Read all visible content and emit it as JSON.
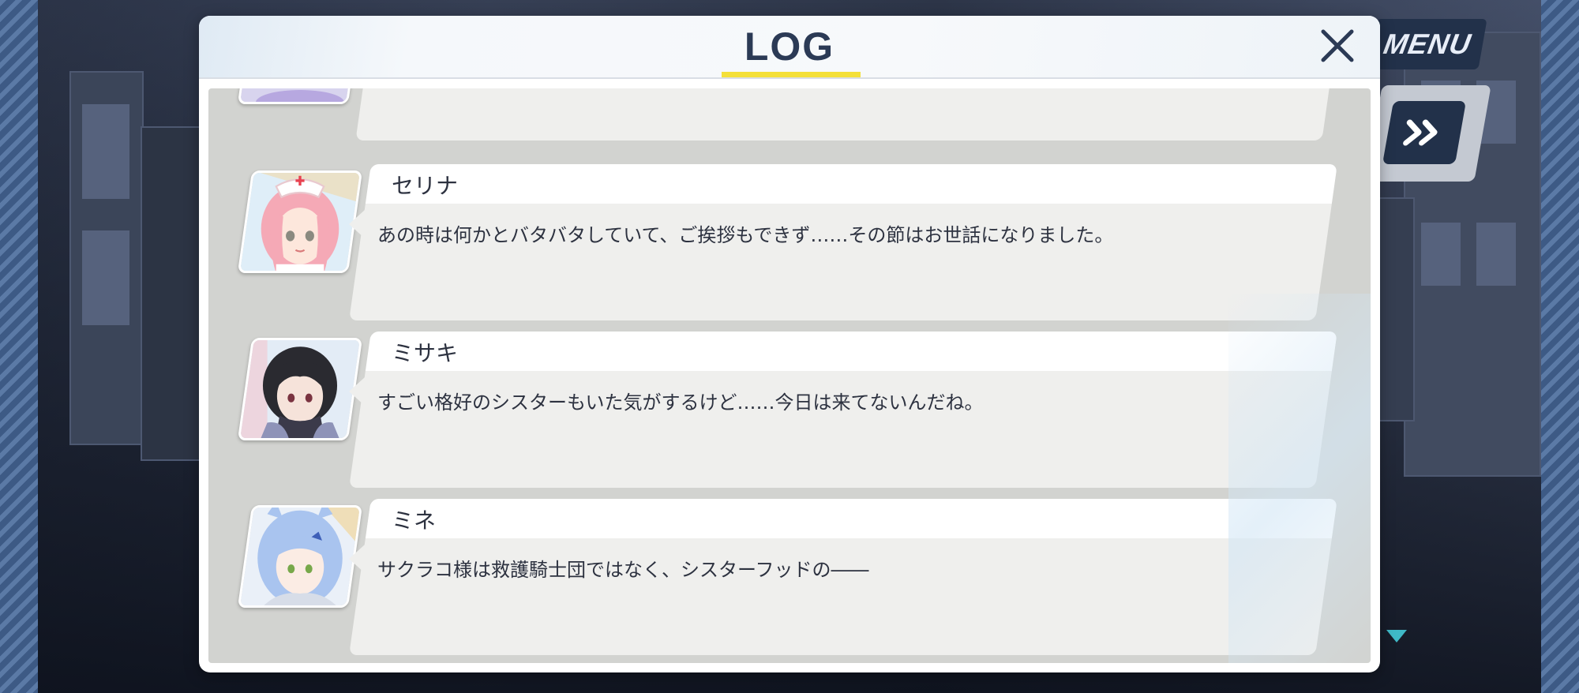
{
  "header": {
    "title": "LOG"
  },
  "controls": {
    "menu_label": "MENU"
  },
  "log_entries": [
    {
      "speaker": "",
      "text": ""
    },
    {
      "speaker": "セリナ",
      "text": "あの時は何かとバタバタしていて、ご挨拶もできず……その節はお世話になりました。"
    },
    {
      "speaker": "ミサキ",
      "text": "すごい格好のシスターもいた気がするけど……今日は来てないんだね。"
    },
    {
      "speaker": "ミネ",
      "text": "サクラコ様は救護騎士団ではなく、シスターフッドの――"
    }
  ],
  "colors": {
    "title_accent": "#f4e03a",
    "button_dark": "#22314a",
    "scroll_arrow": "#3fb9c7"
  }
}
